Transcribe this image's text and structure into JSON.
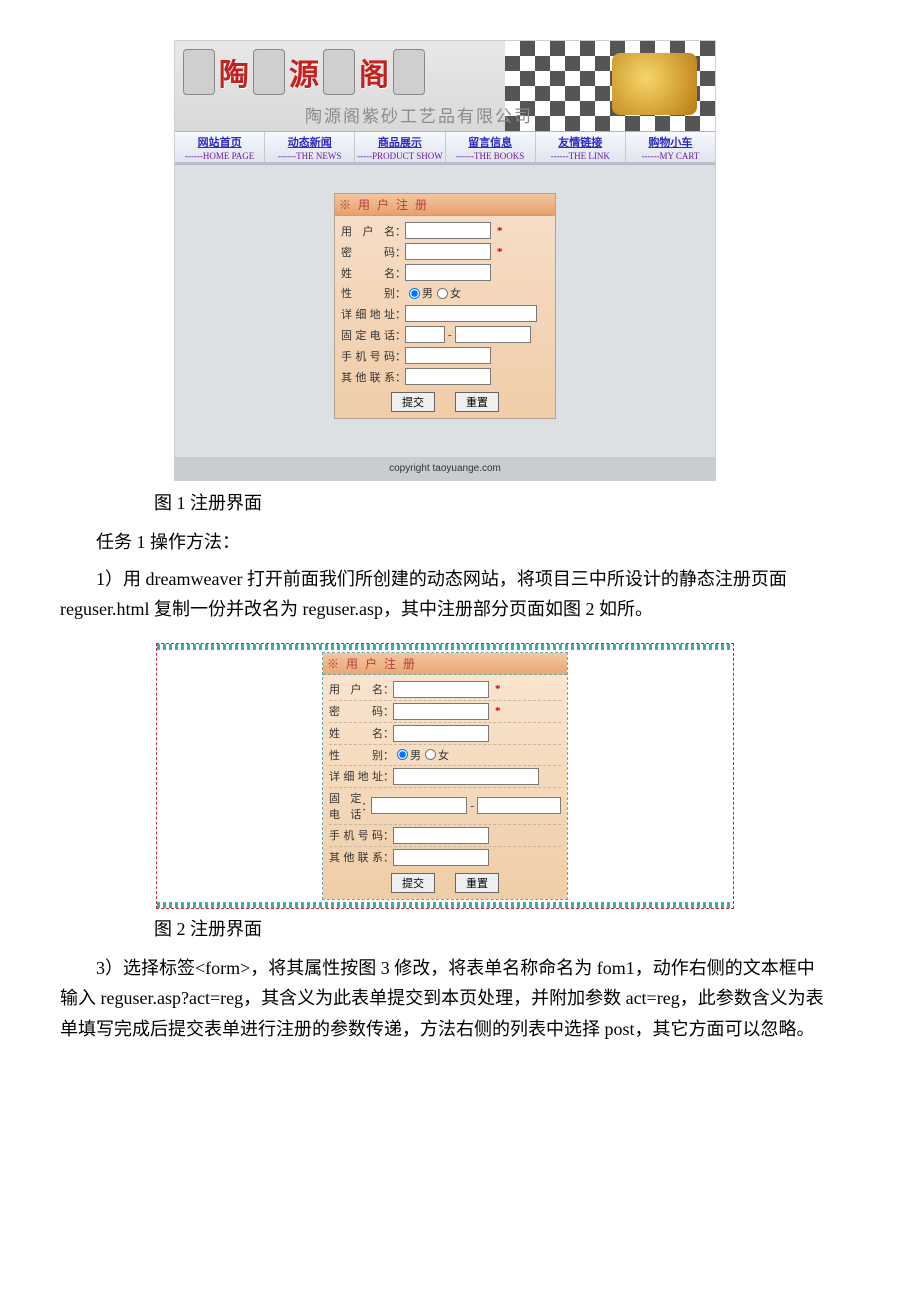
{
  "site": {
    "logo_chars": [
      "陶",
      "源",
      "阁"
    ],
    "subtitle": "陶源阁紫砂工艺品有限公司",
    "nav": [
      {
        "cn": "网站首页",
        "en": "------HOME PAGE"
      },
      {
        "cn": "动态新闻",
        "en": "------THE NEWS"
      },
      {
        "cn": "商品展示",
        "en": "-----PRODUCT SHOW"
      },
      {
        "cn": "留言信息",
        "en": "------THE BOOKS"
      },
      {
        "cn": "友情链接",
        "en": "------THE LINK"
      },
      {
        "cn": "购物小车",
        "en": "------MY CART"
      }
    ],
    "footer": "copyright taoyuange.com"
  },
  "form": {
    "legend": "※ 用 户 注 册",
    "username_label": "用 户 名",
    "password_label": "密    码",
    "name_label": "姓    名",
    "gender_label": "性    别",
    "gender_male": "男",
    "gender_female": "女",
    "address_label": "详细地址",
    "tel_label": "固定电话",
    "mobile_label": "手机号码",
    "other_label": "其他联系",
    "telsep": "-",
    "required": "*",
    "submit": "提交",
    "reset": "重置"
  },
  "form2": {
    "legend": "※ 用 户 注 册",
    "username_label": "用户名",
    "password_label": "密  码",
    "name_label": "姓  名",
    "gender_label": "性  别",
    "address_label": "详细地址",
    "tel_label": "固定电话",
    "mobile_label": "手机号码",
    "other_label": "其他联系"
  },
  "text": {
    "fig1_caption": "图 1 注册界面",
    "task1": "任务 1 操作方法：",
    "p1": "1）用 dreamweaver 打开前面我们所创建的动态网站，将项目三中所设计的静态注册页面 reguser.html 复制一份并改名为 reguser.asp，其中注册部分页面如图 2 如所。",
    "fig2_caption": "图 2 注册界面",
    "p3": "3）选择标签<form>，将其属性按图 3 修改，将表单名称命名为 fom1，动作右侧的文本框中输入 reguser.asp?act=reg，其含义为此表单提交到本页处理，并附加参数 act=reg，此参数含义为表单填写完成后提交表单进行注册的参数传递，方法右侧的列表中选择 post，其它方面可以忽略。"
  }
}
